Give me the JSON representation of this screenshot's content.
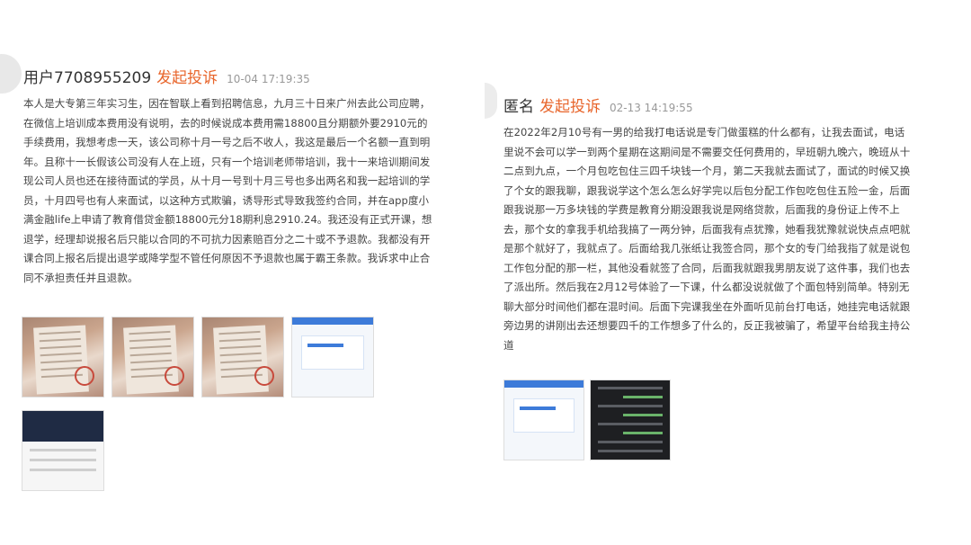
{
  "left": {
    "user": "用户7708955209",
    "action": "发起投诉",
    "time": "10-04 17:19:35",
    "content": "本人是大专第三年实习生，因在智联上看到招聘信息，九月三十日来广州去此公司应聘，\n在微信上培训成本费用没有说明，去的时候说成本费用需18800且分期额外要2910元的\n手续费用，我想考虑一天，该公司称十月一号之后不收人，我这是最后一个名额一直到明\n年。且称十一长假该公司没有人在上班，只有一个培训老师带培训，我十一来培训期间发\n现公司人员也还在接待面试的学员，从十月一号到十月三号也多出两名和我一起培训的学\n员，十月四号也有人来面试，以这种方式欺骗，诱导形式导致我签约合同，并在app度小\n满金融life上申请了教育借贷金额18800元分18期利息2910.24。我还没有正式开课，想\n退学，经理却说报名后只能以合同的不可抗力因素赔百分之二十或不予退款。我都没有开\n课合同上报名后提出退学或降学型不管任何原因不予退款也属于霸王条款。我诉求中止合\n同不承担责任并且退款。"
  },
  "right": {
    "user": "匿名",
    "action": "发起投诉",
    "time": "02-13 14:19:55",
    "content": "在2022年2月10号有一男的给我打电话说是专门做蛋糕的什么都有，让我去面试，电话\n里说不会可以学一到两个星期在这期间是不需要交任何费用的，早班朝九晚六，晚班从十\n二点到九点，一个月包吃包住三四千块钱一个月，第二天我就去面试了，面试的时候又换\n了个女的跟我聊，跟我说学这个怎么怎么好学完以后包分配工作包吃包住五险一金，后面\n跟我说那一万多块钱的学费是教育分期没跟我说是网络贷款，后面我的身份证上传不上\n去，那个女的拿我手机给我搞了一两分钟，后面我有点犹豫，她看我犹豫就说快点点吧就\n是那个就好了，我就点了。后面给我几张纸让我签合同，那个女的专门给我指了就是说包\n工作包分配的那一栏，其他没看就签了合同，后面我就跟我男朋友说了这件事，我们也去\n了派出所。然后我在2月12号体验了一下课，什么都没说就做了个面包特别简单。特别无\n聊大部分时间他们都在混时间。后面下完课我坐在外面听见前台打电话，她挂完电话就跟\n旁边男的讲刚出去还想要四千的工作想多了什么的，反正我被骗了，希望平台给我主持公\n道"
  },
  "colors": {
    "accent": "#e8652b",
    "text": "#444444",
    "muted": "#999999"
  }
}
